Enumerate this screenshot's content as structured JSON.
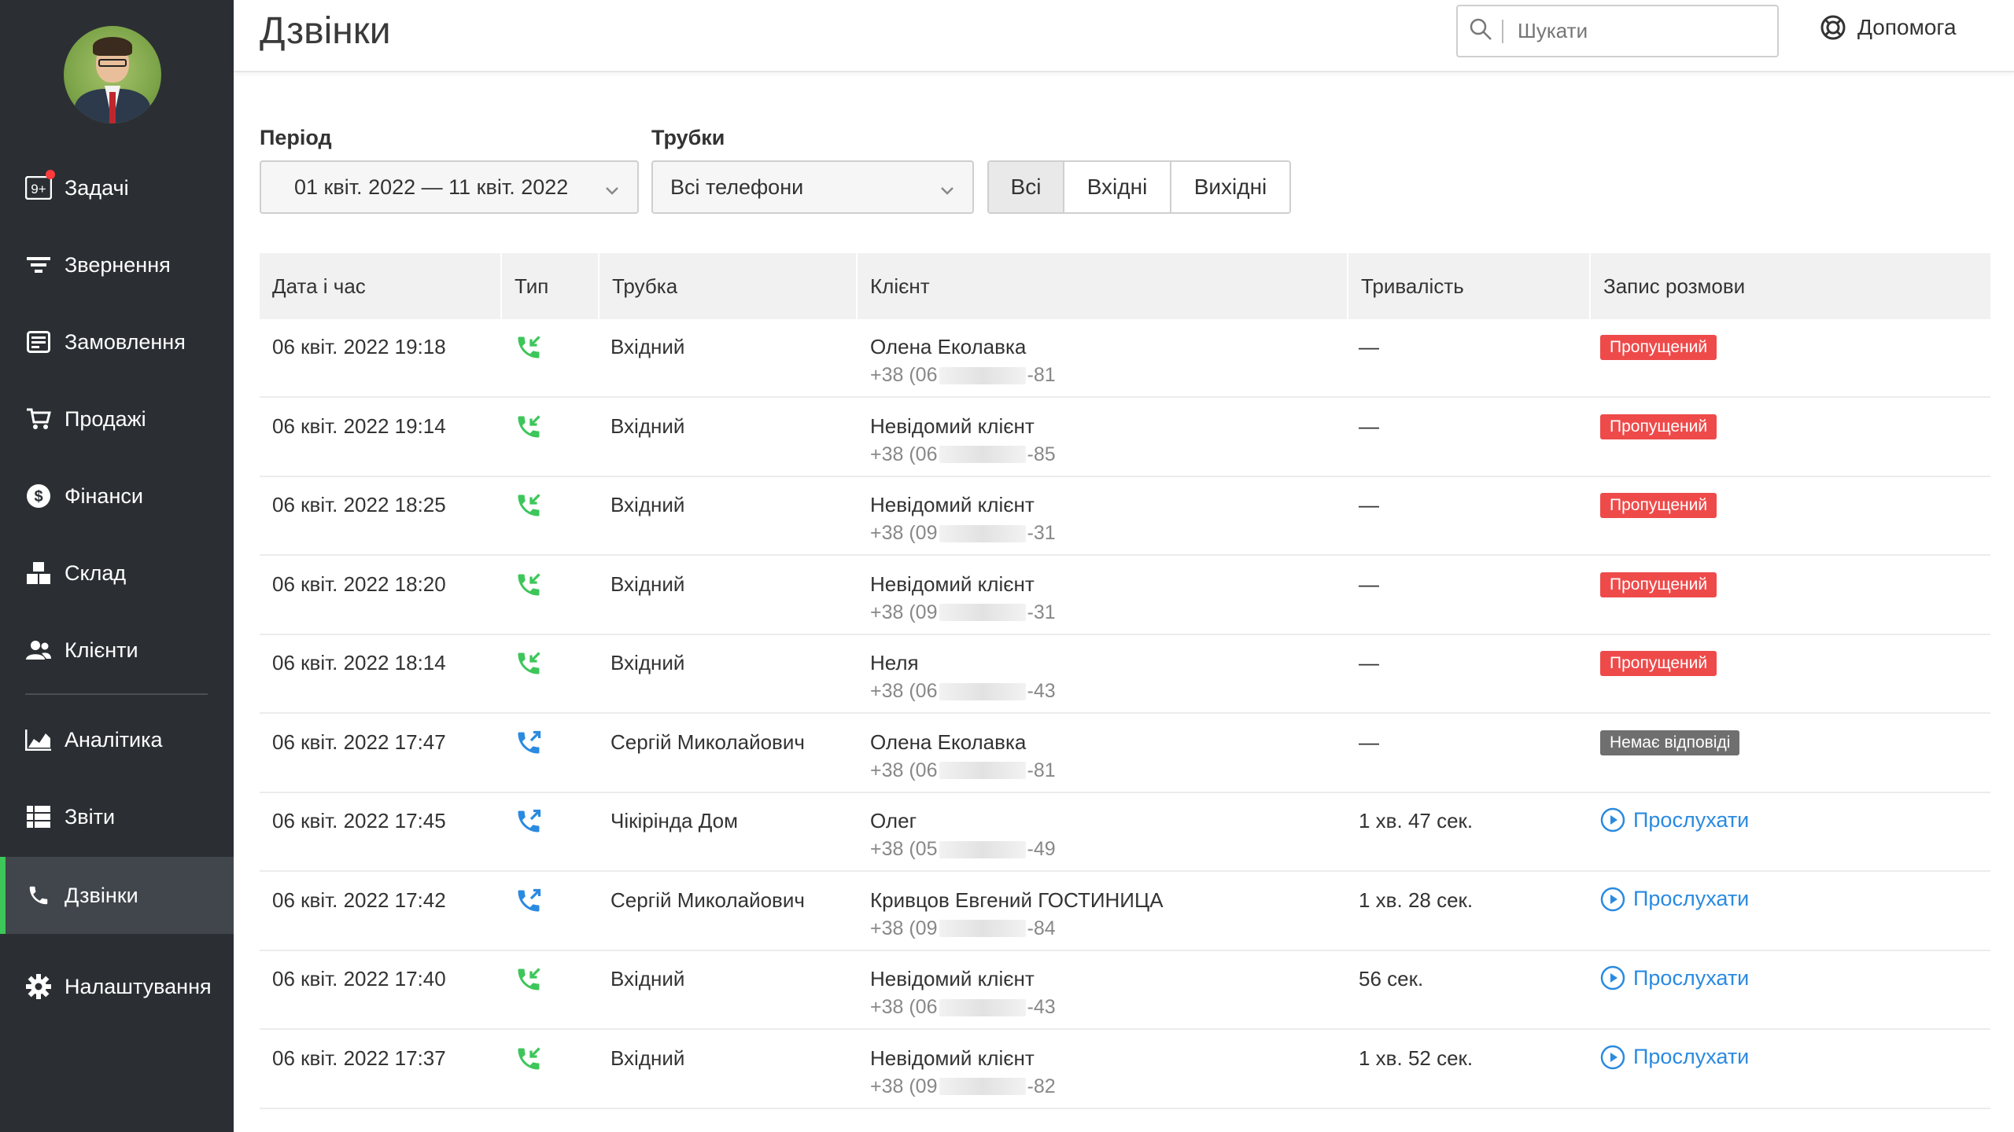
{
  "page": {
    "title": "Дзвінки"
  },
  "search": {
    "placeholder": "Шукати"
  },
  "help": {
    "label": "Допомога"
  },
  "sidebar": {
    "items": [
      {
        "label": "Задачі",
        "icon": "tasks-badge-icon",
        "badge": "9+"
      },
      {
        "label": "Звернення",
        "icon": "filter-icon"
      },
      {
        "label": "Замовлення",
        "icon": "orders-icon"
      },
      {
        "label": "Продажі",
        "icon": "cart-icon"
      },
      {
        "label": "Фінанси",
        "icon": "dollar-icon"
      },
      {
        "label": "Склад",
        "icon": "boxes-icon"
      },
      {
        "label": "Клієнти",
        "icon": "users-icon"
      },
      {
        "label": "Аналітика",
        "icon": "chart-icon"
      },
      {
        "label": "Звіти",
        "icon": "list-icon"
      },
      {
        "label": "Дзвінки",
        "icon": "phone-icon",
        "active": true
      },
      {
        "label": "Налаштування",
        "icon": "gear-icon"
      }
    ]
  },
  "filters": {
    "period_label": "Період",
    "period_value": "01 квіт. 2022 — 11 квіт. 2022",
    "phones_label": "Трубки",
    "phones_value": "Всі телефони",
    "segments": [
      "Всі",
      "Вхідні",
      "Вихідні"
    ],
    "segment_selected": "Всі"
  },
  "table": {
    "columns": [
      "Дата і час",
      "Тип",
      "Трубка",
      "Клієнт",
      "Тривалість",
      "Запис розмови"
    ],
    "rows": [
      {
        "datetime": "06 квіт. 2022 19:18",
        "type": "incoming",
        "handset": "Вхідний",
        "client": "Олена Еколавка",
        "phone_start": "+38 (06",
        "phone_end": "-81",
        "duration": "—",
        "record": "Пропущений",
        "record_kind": "missed"
      },
      {
        "datetime": "06 квіт. 2022 19:14",
        "type": "incoming",
        "handset": "Вхідний",
        "client": "Невідомий клієнт",
        "phone_start": "+38 (06",
        "phone_end": "-85",
        "duration": "—",
        "record": "Пропущений",
        "record_kind": "missed"
      },
      {
        "datetime": "06 квіт. 2022 18:25",
        "type": "incoming",
        "handset": "Вхідний",
        "client": "Невідомий клієнт",
        "phone_start": "+38 (09",
        "phone_end": "-31",
        "duration": "—",
        "record": "Пропущений",
        "record_kind": "missed"
      },
      {
        "datetime": "06 квіт. 2022 18:20",
        "type": "incoming",
        "handset": "Вхідний",
        "client": "Невідомий клієнт",
        "phone_start": "+38 (09",
        "phone_end": "-31",
        "duration": "—",
        "record": "Пропущений",
        "record_kind": "missed"
      },
      {
        "datetime": "06 квіт. 2022 18:14",
        "type": "incoming",
        "handset": "Вхідний",
        "client": "Неля",
        "phone_start": "+38 (06",
        "phone_end": "-43",
        "duration": "—",
        "record": "Пропущений",
        "record_kind": "missed"
      },
      {
        "datetime": "06 квіт. 2022 17:47",
        "type": "outgoing",
        "handset": "Сергій Миколайович",
        "client": "Олена Еколавка",
        "phone_start": "+38 (06",
        "phone_end": "-81",
        "duration": "—",
        "record": "Немає відповіді",
        "record_kind": "noanswer"
      },
      {
        "datetime": "06 квіт. 2022 17:45",
        "type": "outgoing",
        "handset": "Чікірінда Дом",
        "client": "Олег",
        "phone_start": "+38 (05",
        "phone_end": "-49",
        "duration": "1 хв. 47 сек.",
        "record": "Прослухати",
        "record_kind": "listen"
      },
      {
        "datetime": "06 квіт. 2022 17:42",
        "type": "outgoing",
        "handset": "Сергій Миколайович",
        "client": "Кривцов Евгений ГОСТИНИЦА",
        "phone_start": "+38 (09",
        "phone_end": "-84",
        "duration": "1 хв. 28 сек.",
        "record": "Прослухати",
        "record_kind": "listen"
      },
      {
        "datetime": "06 квіт. 2022 17:40",
        "type": "incoming",
        "handset": "Вхідний",
        "client": "Невідомий клієнт",
        "phone_start": "+38 (06",
        "phone_end": "-43",
        "duration": "56 сек.",
        "record": "Прослухати",
        "record_kind": "listen"
      },
      {
        "datetime": "06 квіт. 2022 17:37",
        "type": "incoming",
        "handset": "Вхідний",
        "client": "Невідомий клієнт",
        "phone_start": "+38 (09",
        "phone_end": "-82",
        "duration": "1 хв. 52 сек.",
        "record": "Прослухати",
        "record_kind": "listen"
      }
    ]
  },
  "colors": {
    "sidebar": "#2b2f33",
    "active_marker": "#3dc65a",
    "incoming_icon": "#3dc65a",
    "outgoing_icon": "#2a8ae0",
    "missed": "#ef4a4a",
    "no_answer": "#6f6f6f",
    "link": "#2a8ae0"
  }
}
